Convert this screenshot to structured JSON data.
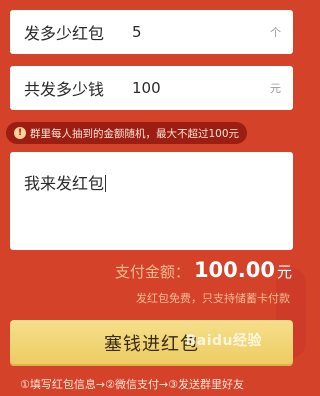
{
  "count_field": {
    "label": "发多少红包",
    "value": "5",
    "unit": "个"
  },
  "amount_field": {
    "label": "共发多少钱",
    "value": "100",
    "unit": "元"
  },
  "hint": {
    "icon": "!",
    "text": "群里每人抽到的金额随机，最大不超过100元"
  },
  "message": {
    "text": "我来发红包"
  },
  "payment": {
    "label": "支付金额：",
    "amount": "100.00",
    "unit": "元"
  },
  "note": "发红包免费，只支持储蓄卡付款",
  "submit_label": "塞钱进红包",
  "steps": "①填写红包信息→②微信支付→③发送群里好友",
  "watermark": "Baidu经验"
}
